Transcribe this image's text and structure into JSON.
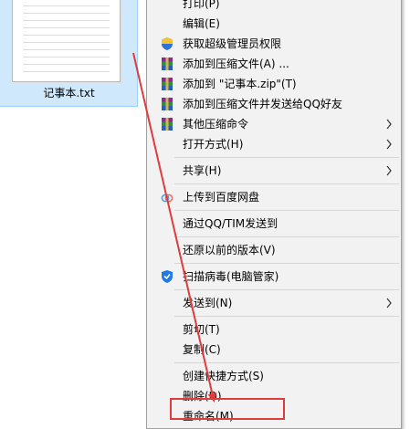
{
  "desktop": {
    "file_name": "记事本.txt"
  },
  "context_menu": {
    "items": [
      {
        "label": "打印(P)",
        "icon": "none"
      },
      {
        "label": "编辑(E)",
        "icon": "none"
      },
      {
        "label": "获取超级管理员权限",
        "icon": "uac-shield-icon"
      },
      {
        "label": "添加到压缩文件(A) ...",
        "icon": "winrar-icon"
      },
      {
        "label": "添加到 \"记事本.zip\"(T)",
        "icon": "winrar-icon"
      },
      {
        "label": "添加到压缩文件并发送给QQ好友",
        "icon": "winrar-icon"
      },
      {
        "label": "其他压缩命令",
        "icon": "winrar-icon"
      },
      {
        "label": "打开方式(H)",
        "icon": "none"
      },
      {
        "label": "共享(H)",
        "icon": "none"
      },
      {
        "label": "上传到百度网盘",
        "icon": "baidu-netdisk-icon"
      },
      {
        "label": "通过QQ/TIM发送到",
        "icon": "none"
      },
      {
        "label": "还原以前的版本(V)",
        "icon": "none"
      },
      {
        "label": "扫描病毒(电脑管家)",
        "icon": "tencent-pc-manager-icon"
      },
      {
        "label": "发送到(N)",
        "icon": "none"
      },
      {
        "label": "剪切(T)",
        "icon": "none"
      },
      {
        "label": "复制(C)",
        "icon": "none"
      },
      {
        "label": "创建快捷方式(S)",
        "icon": "none"
      },
      {
        "label": "删除(D)",
        "icon": "none"
      },
      {
        "label": "重命名(M)",
        "icon": "none"
      }
    ],
    "submenu_arrow": "›"
  },
  "annotation": {
    "highlight_color": "#e23b3b",
    "highlighted_item": "重命名(M)"
  }
}
